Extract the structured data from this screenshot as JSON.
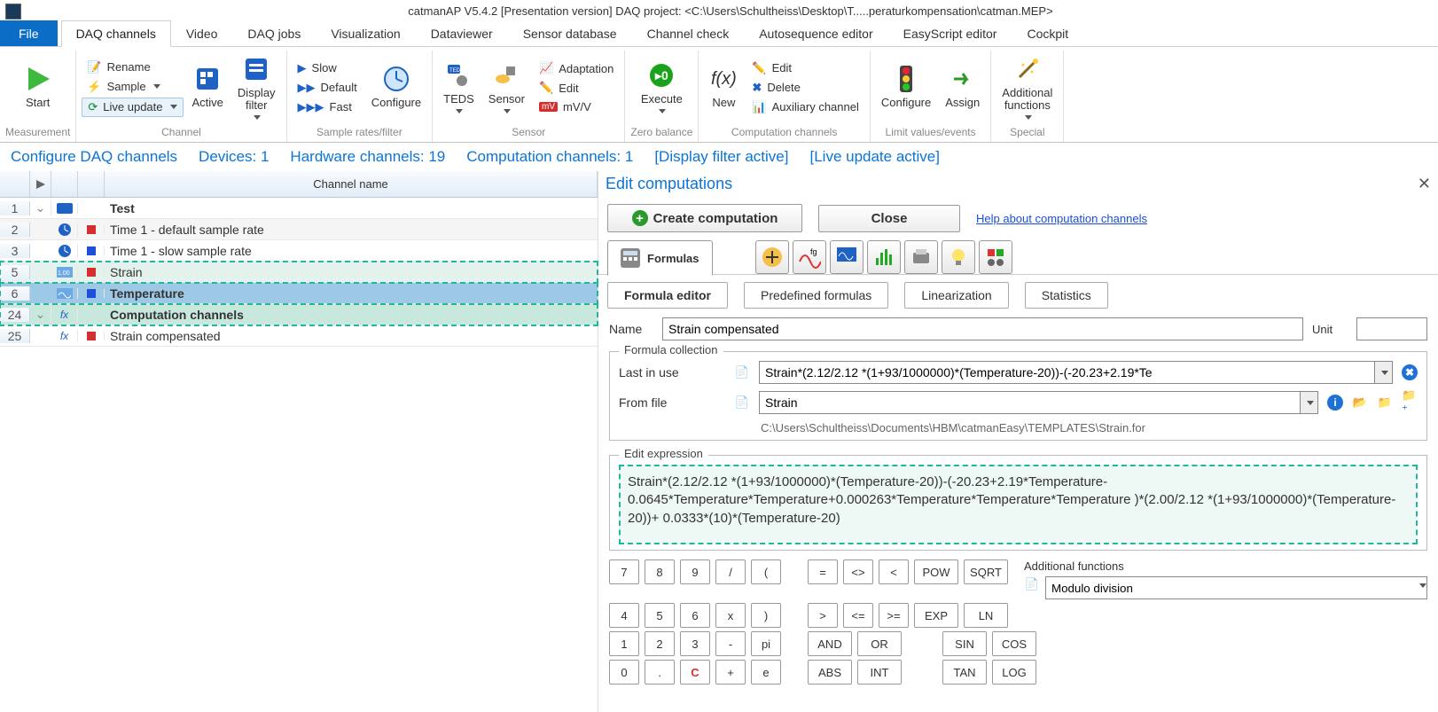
{
  "title": "catmanAP V5.4.2 [Presentation version]  DAQ project: <C:\\Users\\Schultheiss\\Desktop\\T.....peraturkompensation\\catman.MEP>",
  "menutabs": {
    "file": "File",
    "items": [
      "DAQ channels",
      "Video",
      "DAQ jobs",
      "Visualization",
      "Dataviewer",
      "Sensor database",
      "Channel check",
      "Autosequence editor",
      "EasyScript editor",
      "Cockpit"
    ],
    "active_index": 0
  },
  "ribbon": {
    "measurement": {
      "start": "Start",
      "group": "Measurement"
    },
    "channel": {
      "rename": "Rename",
      "sample": "Sample",
      "live": "Live update",
      "active": "Active",
      "display": "Display\nfilter",
      "group": "Channel"
    },
    "rates": {
      "slow": "Slow",
      "default": "Default",
      "fast": "Fast",
      "group": "Sample rates/filter"
    },
    "configure": "Configure",
    "sensor": {
      "teds": "TEDS",
      "sensor": "Sensor",
      "adaptation": "Adaptation",
      "edit": "Edit",
      "mvv": "mV/V",
      "group": "Sensor"
    },
    "zero": {
      "execute": "Execute",
      "group": "Zero balance"
    },
    "comp": {
      "new": "New",
      "edit": "Edit",
      "delete": "Delete",
      "aux": "Auxiliary channel",
      "group": "Computation channels"
    },
    "limits": {
      "configure": "Configure",
      "assign": "Assign",
      "group": "Limit values/events"
    },
    "special": {
      "addfn": "Additional\nfunctions",
      "group": "Special"
    }
  },
  "status_links": [
    "Configure DAQ channels",
    "Devices: 1",
    "Hardware channels: 19",
    "Computation channels: 1",
    "[Display filter active]",
    "[Live update active]"
  ],
  "grid": {
    "header": "Channel name",
    "rows": [
      {
        "n": "1",
        "name": "Test",
        "bold": true,
        "exp": "⌄",
        "ico": "dev"
      },
      {
        "n": "2",
        "name": "Time  1 - default sample rate",
        "sq": "red",
        "ico": "clock"
      },
      {
        "n": "3",
        "name": "Time  1 - slow sample rate",
        "sq": "blue",
        "ico": "clock"
      },
      {
        "n": "5",
        "name": "Strain",
        "sq": "red",
        "ico": "sig",
        "hl": "dash-green"
      },
      {
        "n": "6",
        "name": "Temperature",
        "sq": "blue",
        "ico": "sig",
        "selected": true,
        "hl": "dash"
      },
      {
        "n": "24",
        "name": "Computation channels",
        "bold": true,
        "exp": "⌄",
        "ico": "fx",
        "hl": "dash-green"
      },
      {
        "n": "25",
        "name": "Strain compensated",
        "sq": "red",
        "ico": "fx"
      }
    ]
  },
  "right": {
    "title": "Edit computations",
    "create": "Create computation",
    "close": "Close",
    "help": "Help about computation channels",
    "formulas_tab": "Formulas",
    "tabs2": [
      "Formula editor",
      "Predefined formulas",
      "Linearization",
      "Statistics"
    ],
    "name_label": "Name",
    "name_value": "Strain compensated",
    "unit_label": "Unit",
    "formula_collection": "Formula collection",
    "last_in_use": "Last in use",
    "from_file": "From file",
    "last_value": "Strain*(2.12/2.12 *(1+93/1000000)*(Temperature-20))-(-20.23+2.19*Te",
    "from_file_value": "Strain",
    "from_file_path": "C:\\Users\\Schultheiss\\Documents\\HBM\\catmanEasy\\TEMPLATES\\Strain.for",
    "edit_expression": "Edit expression",
    "expression": "Strain*(2.12/2.12 *(1+93/1000000)*(Temperature-20))-(-20.23+2.19*Temperature-0.0645*Temperature*Temperature+0.000263*Temperature*Temperature*Temperature )*(2.00/2.12 *(1+93/1000000)*(Temperature-20))+ 0.0333*(10)*(Temperature-20)",
    "calc": {
      "r1": [
        "7",
        "8",
        "9",
        "/",
        "("
      ],
      "r2": [
        "4",
        "5",
        "6",
        "x",
        ")"
      ],
      "r3": [
        "1",
        "2",
        "3",
        "-",
        "pi"
      ],
      "r4": [
        "0",
        ".",
        "C",
        "+",
        "e"
      ],
      "o1": [
        "=",
        "<>",
        "<",
        "POW",
        "SQRT"
      ],
      "o2": [
        ">",
        "<=",
        ">=",
        "EXP",
        "LN"
      ],
      "o3": [
        "AND",
        "OR",
        "",
        "SIN",
        "COS"
      ],
      "o4": [
        "ABS",
        "INT",
        "",
        "TAN",
        "LOG"
      ]
    },
    "addfn_label": "Additional functions",
    "addfn_value": "Modulo division"
  }
}
